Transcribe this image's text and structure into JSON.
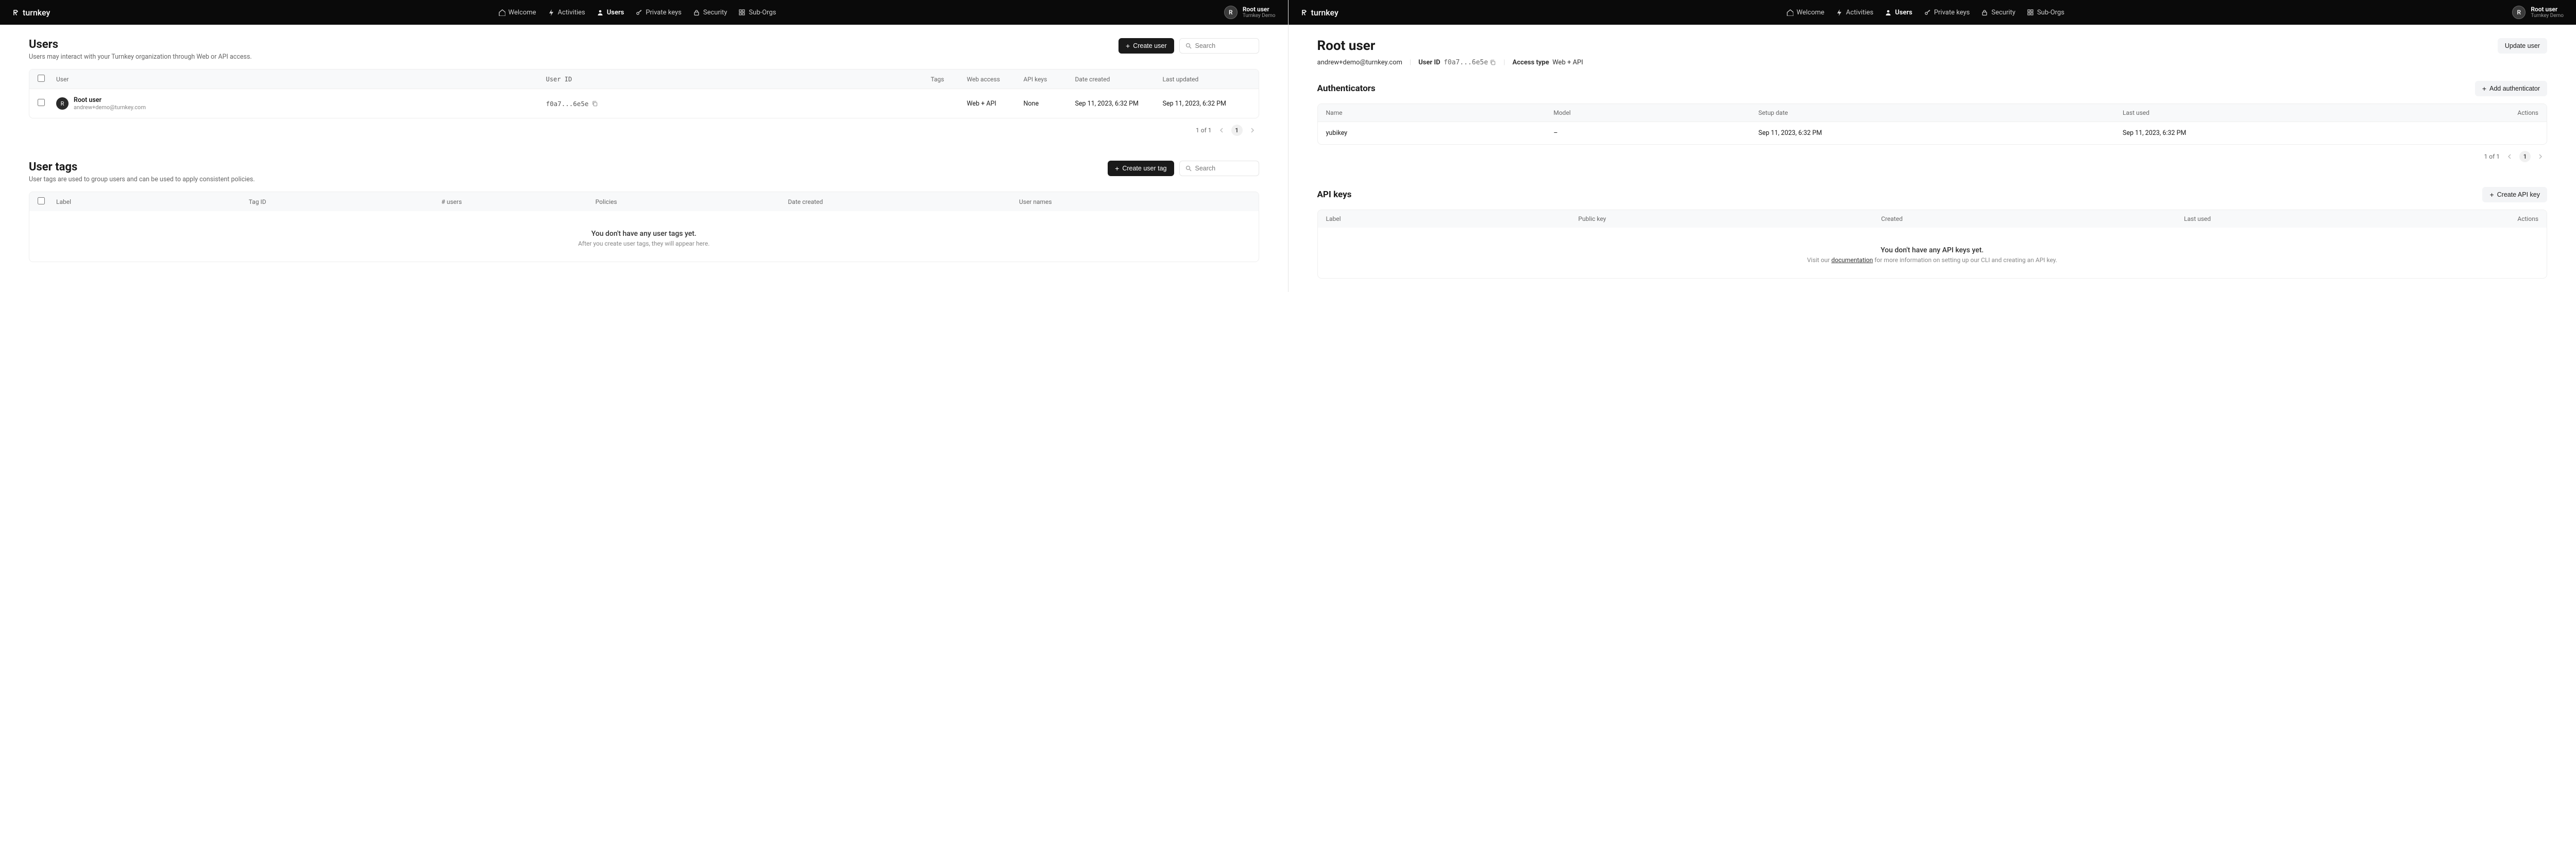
{
  "nav": {
    "brand": "turnkey",
    "links": [
      {
        "label": "Welcome",
        "icon": "home"
      },
      {
        "label": "Activities",
        "icon": "bolt"
      },
      {
        "label": "Users",
        "icon": "user",
        "active": true
      },
      {
        "label": "Private keys",
        "icon": "key"
      },
      {
        "label": "Security",
        "icon": "lock"
      },
      {
        "label": "Sub-Orgs",
        "icon": "grid"
      }
    ],
    "user": {
      "initial": "R",
      "name": "Root user",
      "org": "Turnkey Demo"
    }
  },
  "users": {
    "title": "Users",
    "subtitle": "Users may interact with your Turnkey organization through Web or API access.",
    "create_btn": "Create user",
    "search_ph": "Search",
    "columns": {
      "user": "User",
      "uid": "User ID",
      "tags": "Tags",
      "web": "Web access",
      "api": "API keys",
      "created": "Date created",
      "updated": "Last updated"
    },
    "rows": [
      {
        "initial": "R",
        "name": "Root user",
        "email": "andrew+demo@turnkey.com",
        "uid": "f0a7...6e5e",
        "tags": "",
        "web": "Web + API",
        "api": "None",
        "created": "Sep 11, 2023, 6:32 PM",
        "updated": "Sep 11, 2023, 6:32 PM"
      }
    ],
    "pager": {
      "text": "1 of 1",
      "page": "1"
    }
  },
  "tags": {
    "title": "User tags",
    "subtitle": "User tags are used to group users and can be used to apply consistent policies.",
    "create_btn": "Create user tag",
    "search_ph": "Search",
    "columns": {
      "label": "Label",
      "tid": "Tag ID",
      "nu": "# users",
      "pol": "Policies",
      "dc": "Date created",
      "un": "User names"
    },
    "empty": {
      "l1": "You don't have any user tags yet.",
      "l2": "After you create user tags, they will appear here."
    }
  },
  "detail": {
    "title": "Root user",
    "email": "andrew+demo@turnkey.com",
    "uid_label": "User ID",
    "uid": "f0a7...6e5e",
    "access_label": "Access type",
    "access": "Web + API",
    "update_btn": "Update user"
  },
  "auth": {
    "title": "Authenticators",
    "add_btn": "Add authenticator",
    "columns": {
      "name": "Name",
      "model": "Model",
      "setup": "Setup date",
      "last": "Last used",
      "act": "Actions"
    },
    "rows": [
      {
        "name": "yubikey",
        "model": "–",
        "setup": "Sep 11, 2023, 6:32 PM",
        "last": "Sep 11, 2023, 6:32 PM"
      }
    ],
    "pager": {
      "text": "1 of 1",
      "page": "1"
    }
  },
  "keys": {
    "title": "API keys",
    "add_btn": "Create API key",
    "columns": {
      "label": "Label",
      "pk": "Public key",
      "cr": "Created",
      "lu": "Last used",
      "act": "Actions"
    },
    "empty": {
      "l1": "You don't have any API keys yet.",
      "l2a": "Visit our ",
      "l2link": "documentation",
      "l2b": " for more information on setting up our CLI and creating an API key."
    }
  }
}
